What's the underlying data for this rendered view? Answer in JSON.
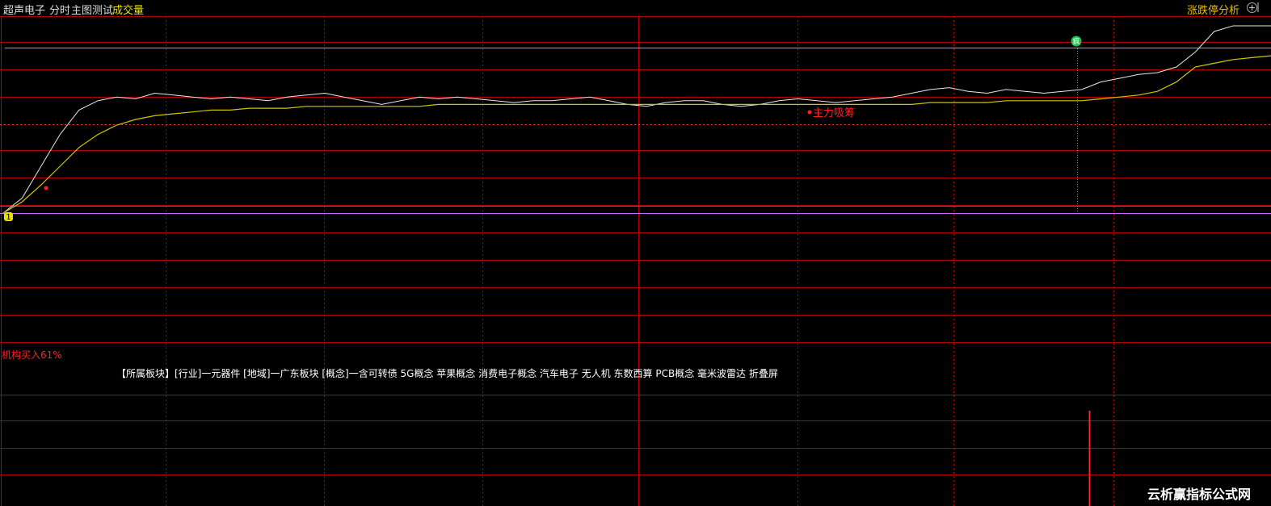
{
  "header": {
    "stock_name": "超声电子",
    "mode": "分时",
    "main_indicator": "主图测试",
    "volume_label": "成交量",
    "right_label": "涨跌停分析"
  },
  "annotations": {
    "marker_start": "1",
    "marker_end": "疯",
    "main_force": "主力吸筹",
    "institution": "机构买入61%"
  },
  "sectors_text": "【所属板块】[行业]一元器件 [地域]一广东板块 [概念]一含可转债 5G概念 苹果概念 消费电子概念 汽车电子 无人机 东数西算 PCB概念 毫米波雷达 折叠屏",
  "watermark": "云析赢指标公式网",
  "colors": {
    "grid": "#b30000",
    "price": "#e8e8e8",
    "avg": "#d4c400",
    "limit_up": "#33cccc",
    "base": "#cc66ff",
    "red_text": "#ff2020",
    "marker_green": "#22bb55",
    "marker_yellow": "#e8e000"
  },
  "chart_data": {
    "type": "line",
    "series": [
      {
        "values": [
          0,
          0.08,
          0.25,
          0.42,
          0.55,
          0.6,
          0.62,
          0.61,
          0.64,
          0.63,
          0.62,
          0.61,
          0.62,
          0.61,
          0.6,
          0.62,
          0.63,
          0.64,
          0.62,
          0.6,
          0.58,
          0.6,
          0.62,
          0.61,
          0.62,
          0.61,
          0.6,
          0.59,
          0.6,
          0.6,
          0.61,
          0.62,
          0.6,
          0.58,
          0.57,
          0.59,
          0.6,
          0.6,
          0.58,
          0.57,
          0.58,
          0.6,
          0.61,
          0.6,
          0.59,
          0.6,
          0.61,
          0.62,
          0.64,
          0.66,
          0.67,
          0.65,
          0.64,
          0.66,
          0.65,
          0.64,
          0.65,
          0.66,
          0.7,
          0.72,
          0.74,
          0.75,
          0.78,
          0.86,
          0.97,
          1.0,
          1.0,
          1.0
        ]
      },
      {
        "values": [
          0,
          0.06,
          0.15,
          0.25,
          0.35,
          0.42,
          0.47,
          0.5,
          0.52,
          0.53,
          0.54,
          0.55,
          0.55,
          0.56,
          0.56,
          0.56,
          0.57,
          0.57,
          0.57,
          0.57,
          0.57,
          0.57,
          0.57,
          0.58,
          0.58,
          0.58,
          0.58,
          0.58,
          0.58,
          0.58,
          0.58,
          0.58,
          0.58,
          0.58,
          0.58,
          0.58,
          0.58,
          0.58,
          0.58,
          0.58,
          0.58,
          0.58,
          0.58,
          0.58,
          0.58,
          0.58,
          0.58,
          0.58,
          0.58,
          0.59,
          0.59,
          0.59,
          0.59,
          0.6,
          0.6,
          0.6,
          0.6,
          0.6,
          0.61,
          0.62,
          0.63,
          0.65,
          0.7,
          0.78,
          0.8,
          0.82,
          0.83,
          0.84
        ]
      }
    ]
  }
}
